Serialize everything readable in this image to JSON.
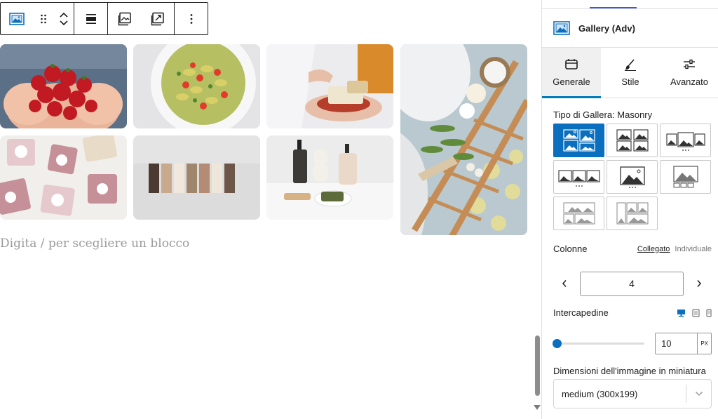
{
  "toolbar": {
    "buttons": [
      "gallery-block-icon",
      "drag-handle-icon",
      "move-up-icon",
      "move-down-icon",
      "align-icon",
      "replace-image-icon",
      "crop-icon",
      "more-options-icon"
    ]
  },
  "editor": {
    "placeholder": "Digita / per scegliere un blocco",
    "gallery_images": [
      "strawberries in hands",
      "farfalle pasta salad",
      "hands holding soap bars",
      "handmade soaps with labels",
      "row of soap bars",
      "bathroom bottles and soap",
      "bath tray with candles"
    ]
  },
  "sidebar": {
    "block_title": "Gallery (Adv)",
    "tabs": [
      {
        "label": "Generale",
        "icon": "table-icon",
        "active": true
      },
      {
        "label": "Stile",
        "icon": "brush-icon",
        "active": false
      },
      {
        "label": "Avanzato",
        "icon": "sliders-icon",
        "active": false
      }
    ],
    "gallery_type_label": "Tipo di Gallera: Masonry",
    "layouts": [
      "masonry",
      "grid",
      "carousel",
      "fluid-carousel",
      "slider",
      "thumbnail-slider",
      "tiles",
      "mosaic"
    ],
    "selected_layout": "masonry",
    "columns_label": "Colonne",
    "columns_mode_linked": "Collegato",
    "columns_mode_individual": "Individuale",
    "columns_value": "4",
    "gap_label": "Intercapedine",
    "gap_devices": [
      "desktop-icon",
      "tablet-icon",
      "mobile-icon"
    ],
    "gap_value": "10",
    "gap_unit": "PX",
    "gap_fraction": 0.0,
    "thumb_label": "Dimensioni dell'immagine in miniatura",
    "thumb_value": "medium (300x199)"
  },
  "colors": {
    "accent": "#0b6fbf",
    "tab_underline": "#007cba",
    "border": "#1e1e1e"
  }
}
